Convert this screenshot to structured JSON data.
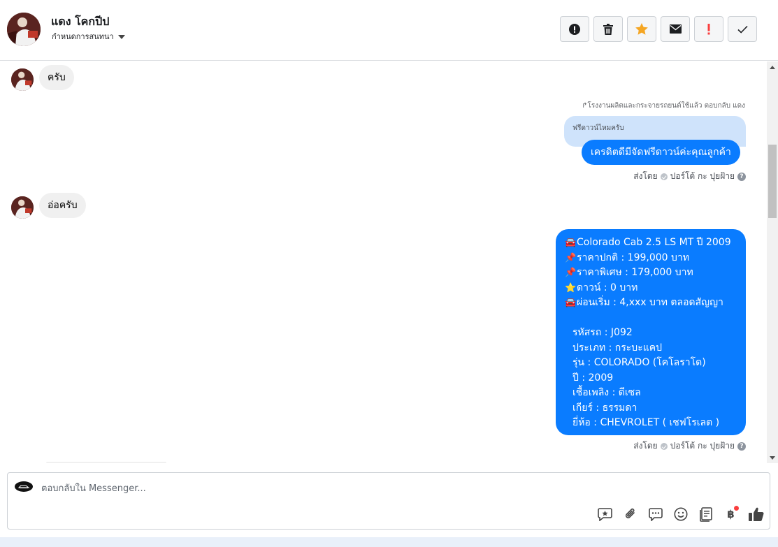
{
  "header": {
    "contact_name": "แดง โคกปีป",
    "assign_label": "กำหนดการสนทนา"
  },
  "toolbar": {
    "icons": [
      "alert-circle-icon",
      "trash-icon",
      "star-icon",
      "envelope-icon",
      "exclamation-icon",
      "check-icon"
    ],
    "star_color": "#f5a623",
    "exclamation_color": "#fa3e3e"
  },
  "messages": {
    "incoming_1": "ครับ",
    "reply_note": "โรงงานผลิตและกระจายรถยนต์ใช้แล้ว ตอบกลับ แดง",
    "quoted_text": "ฟรีดาวน์ไหมครับ",
    "outgoing_1": "เครดิตดีมีจัดฟรีดาวน์ค่ะคุณลูกค้า",
    "sent_by_1": "ส่งโดย",
    "sender_1": "ปอร์โต้ กะ ปุยฝ้าย",
    "incoming_2": "อ่อครับ",
    "outgoing_2_lines": [
      "Colorado Cab 2.5 LS MT ปี 2009",
      "ราคาปกติ : 199,000 บาท",
      "ราคาพิเศษ : 179,000 บาท",
      "ดาวน์ : 0 บาท",
      "ผ่อนเริ่ม : 4,xxx บาท ตลอดสัญญา",
      "",
      "รหัสรถ : J092",
      "ประเภท : กระบะแคป",
      "รุ่น : COLORADO (โคโลราโด)",
      "ปี : 2009",
      "เชื้อเพลิง : ดีเซล",
      "เกียร์ : ธรรมดา",
      "ยี่ห้อ : CHEVROLET ( เชฟโรเลต )"
    ],
    "outgoing_2_emojis": [
      "🚘",
      "📌",
      "📌",
      "⭐",
      "🚘",
      "",
      "",
      "",
      "",
      "",
      "",
      "",
      ""
    ],
    "sent_by_2": "ส่งโดย",
    "sender_2": "ปอร์โต้ กะ ปุยฝ้าย"
  },
  "composer": {
    "placeholder": "ตอบกลับใน Messenger...",
    "tools": [
      "saved-reply-icon",
      "attachment-icon",
      "chat-bubble-icon",
      "emoji-icon",
      "notes-icon",
      "baht-icon",
      "thumbs-up-icon"
    ],
    "baht_symbol": "฿"
  },
  "colors": {
    "outgoing_bubble": "#0a7cff",
    "incoming_bubble": "#f0f0f0",
    "quoted_bubble": "#cfe3fb"
  }
}
